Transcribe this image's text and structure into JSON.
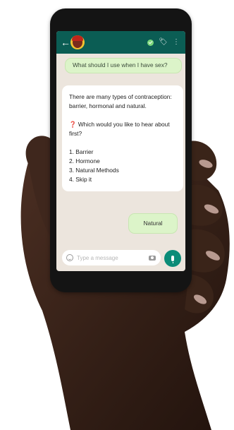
{
  "chat": {
    "messages": [
      {
        "direction": "outgoing",
        "text": "What should I use when I have sex?"
      },
      {
        "direction": "incoming",
        "intro": "There are many types of contraception: barrier, hormonal and natural.",
        "prompt_icon": "❓",
        "prompt": "Which would you like to hear about first?",
        "options": [
          "1. Barrier",
          "2. Hormone",
          "3. Natural Methods",
          "4. Skip it"
        ]
      },
      {
        "direction": "outgoing",
        "text": "Natural"
      }
    ]
  },
  "input": {
    "placeholder": "Type a message"
  },
  "icons": {
    "back": "back-arrow-icon",
    "avatar": "contact-avatar",
    "verified": "verified-badge-icon",
    "attach": "tag-icon",
    "menu": "more-vert-icon",
    "emoji": "emoji-icon",
    "camera": "camera-icon",
    "mic": "mic-icon"
  },
  "colors": {
    "header": "#0b5d54",
    "chat_background": "#ece5dd",
    "outgoing_bubble": "#dcf4c9",
    "incoming_bubble": "#ffffff",
    "mic_button": "#0b8c78"
  }
}
